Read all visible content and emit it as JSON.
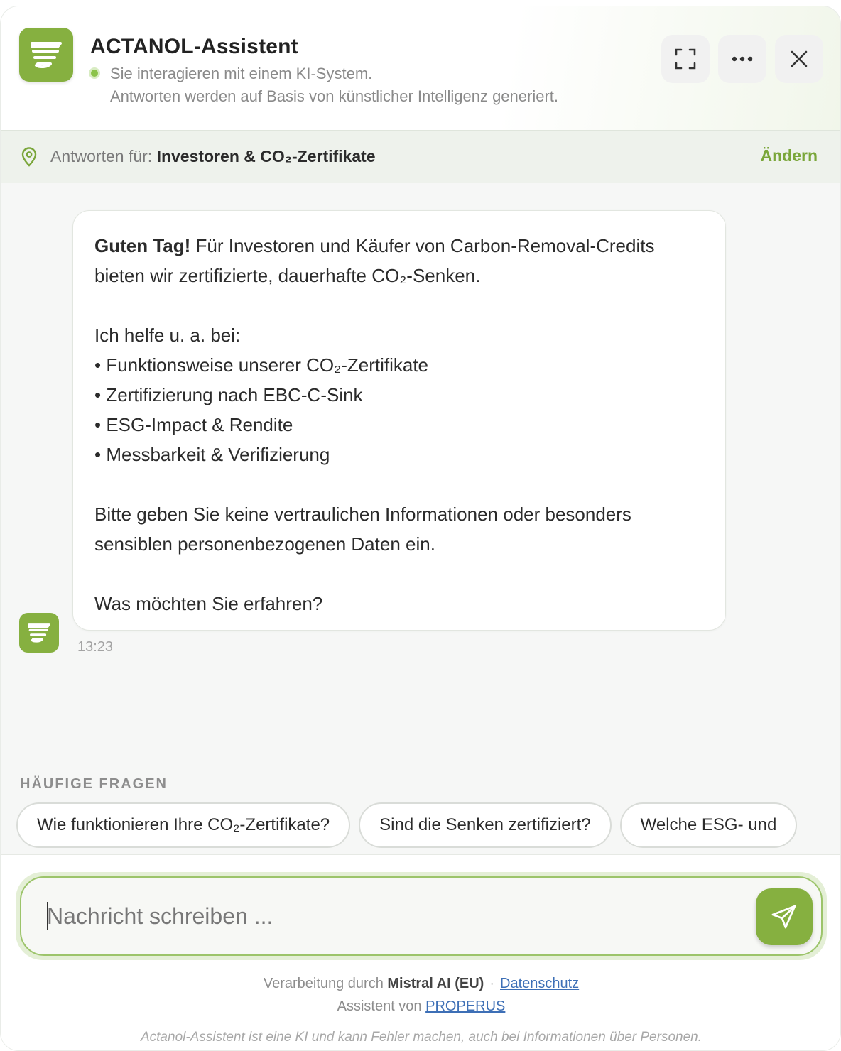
{
  "header": {
    "title": "ACTANOL-Assistent",
    "status_line1": "Sie interagieren mit einem KI-System.",
    "status_line2": "Antworten werden auf Basis von künstlicher Intelligenz generiert.",
    "icons": [
      "expand-icon",
      "more-icon",
      "close-icon"
    ]
  },
  "context": {
    "label": "Antworten für: ",
    "value": "Investoren & CO₂-Zertifikate",
    "change": "Ändern"
  },
  "message": {
    "greeting_bold": "Guten Tag!",
    "intro": " Für Investoren und Käufer von Carbon-Removal-Credits bieten wir zertifizierte, dauerhafte CO₂-Senken.",
    "help_intro": "Ich helfe u. a. bei:",
    "items": [
      "Funktionsweise unserer CO₂-Zertifikate",
      "Zertifizierung nach EBC-C-Sink",
      "ESG-Impact & Rendite",
      "Messbarkeit & Verifizierung"
    ],
    "privacy": "Bitte geben Sie keine vertraulichen Informationen oder besonders sensiblen personenbezogenen Daten ein.",
    "question": "Was möchten Sie erfahren?",
    "time": "13:23"
  },
  "faq": {
    "title": "HÄUFIGE FRAGEN",
    "chips": [
      "Wie funktionieren Ihre CO₂-Zertifikate?",
      "Sind die Senken zertifiziert?",
      "Welche ESG- und"
    ]
  },
  "composer": {
    "placeholder": "Nachricht schreiben ..."
  },
  "footer": {
    "processing_prefix": "Verarbeitung durch ",
    "processor": "Mistral AI (EU)",
    "separator": "·",
    "privacy_link": "Datenschutz",
    "assistant_prefix": "Assistent von ",
    "assistant_link": "PROPERUS",
    "disclaimer": "Actanol-Assistent ist eine KI und kann Fehler machen, auch bei Informationen über Personen."
  },
  "colors": {
    "brand_green": "#86b040",
    "accent_text_green": "#7aa63a",
    "link_blue": "#3d6fb6"
  }
}
